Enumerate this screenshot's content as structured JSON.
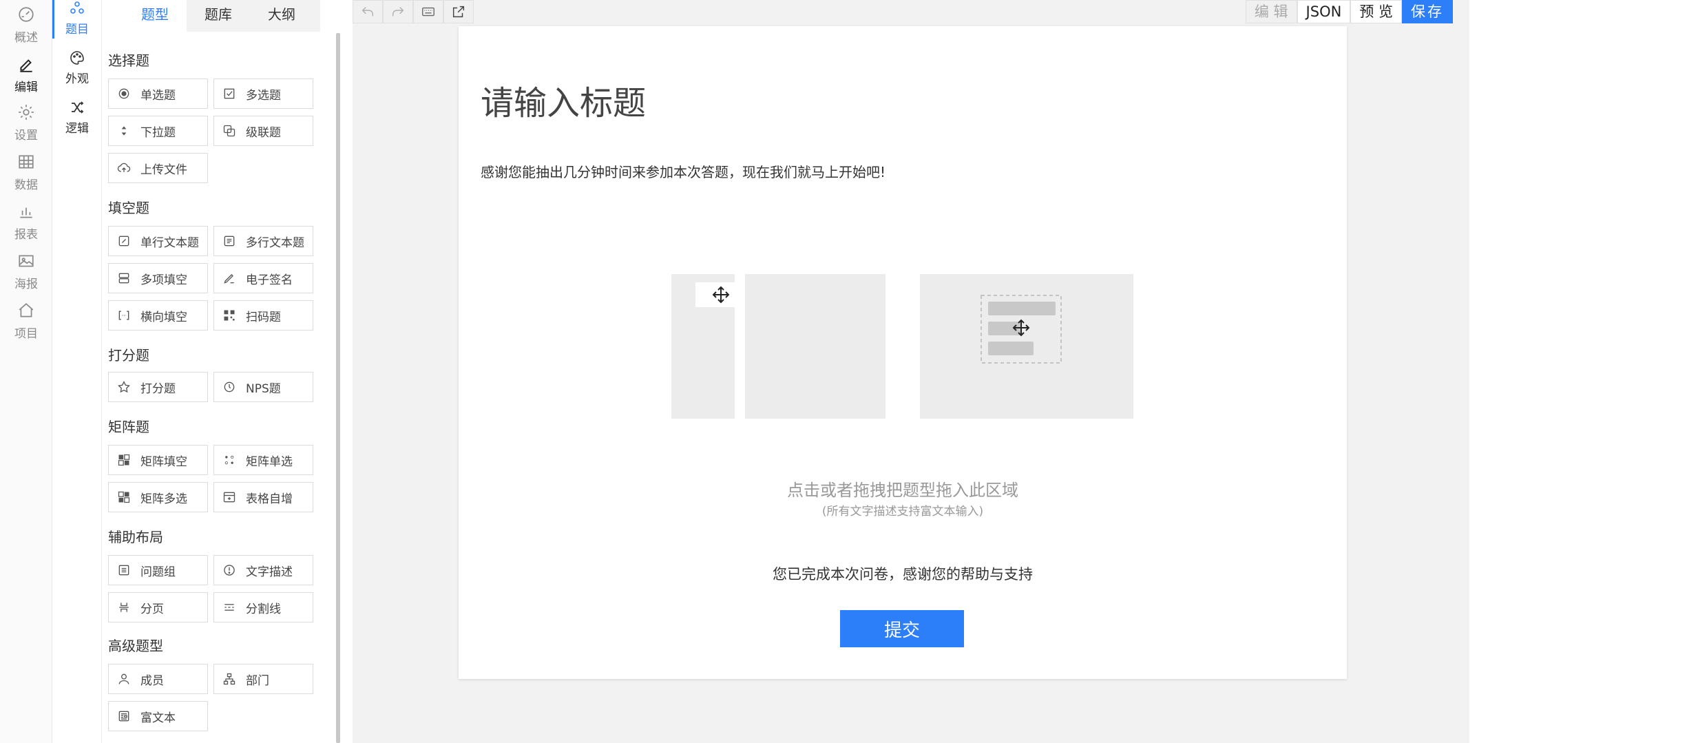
{
  "nav_primary": [
    {
      "label": "概述",
      "icon": "dashboard-icon",
      "active": false
    },
    {
      "label": "编辑",
      "icon": "pen-icon",
      "active": true
    },
    {
      "label": "设置",
      "icon": "gear-icon",
      "active": false
    },
    {
      "label": "数据",
      "icon": "table-icon",
      "active": false
    },
    {
      "label": "报表",
      "icon": "bar-chart-icon",
      "active": false
    },
    {
      "label": "海报",
      "icon": "image-icon",
      "active": false
    },
    {
      "label": "项目",
      "icon": "home-icon",
      "active": false
    }
  ],
  "nav_secondary": [
    {
      "label": "题目",
      "icon": "grid-circles-icon",
      "active": true
    },
    {
      "label": "外观",
      "icon": "palette-icon",
      "active": false
    },
    {
      "label": "逻辑",
      "icon": "shuffle-icon",
      "active": false
    }
  ],
  "panel_tabs": [
    "题型",
    "题库",
    "大纲"
  ],
  "categories": [
    {
      "title": "选择题",
      "items": [
        {
          "label": "单选题",
          "icon": "radio-icon"
        },
        {
          "label": "多选题",
          "icon": "checkbox-icon"
        },
        {
          "label": "下拉题",
          "icon": "dropdown-icon"
        },
        {
          "label": "级联题",
          "icon": "cascade-icon"
        },
        {
          "label": "上传文件",
          "icon": "upload-cloud-icon"
        }
      ]
    },
    {
      "title": "填空题",
      "items": [
        {
          "label": "单行文本题",
          "icon": "edit-box-icon"
        },
        {
          "label": "多行文本题",
          "icon": "multiline-icon"
        },
        {
          "label": "多项填空",
          "icon": "multi-fill-icon"
        },
        {
          "label": "电子签名",
          "icon": "signature-icon"
        },
        {
          "label": "横向填空",
          "icon": "bracket-icon"
        },
        {
          "label": "扫码题",
          "icon": "qrcode-icon"
        }
      ]
    },
    {
      "title": "打分题",
      "items": [
        {
          "label": "打分题",
          "icon": "star-icon"
        },
        {
          "label": "NPS题",
          "icon": "nps-icon"
        }
      ]
    },
    {
      "title": "矩阵题",
      "items": [
        {
          "label": "矩阵填空",
          "icon": "matrix-fill-icon"
        },
        {
          "label": "矩阵单选",
          "icon": "matrix-radio-icon"
        },
        {
          "label": "矩阵多选",
          "icon": "matrix-check-icon"
        },
        {
          "label": "表格自增",
          "icon": "table-add-icon"
        }
      ]
    },
    {
      "title": "辅助布局",
      "items": [
        {
          "label": "问题组",
          "icon": "group-icon"
        },
        {
          "label": "文字描述",
          "icon": "alert-circle-icon"
        },
        {
          "label": "分页",
          "icon": "page-break-icon"
        },
        {
          "label": "分割线",
          "icon": "divider-icon"
        }
      ]
    },
    {
      "title": "高级题型",
      "items": [
        {
          "label": "成员",
          "icon": "user-icon"
        },
        {
          "label": "部门",
          "icon": "org-icon"
        },
        {
          "label": "富文本",
          "icon": "rich-text-icon"
        }
      ]
    }
  ],
  "toolbar": {
    "undo_icon": "undo-icon",
    "redo_icon": "redo-icon",
    "keyboard_icon": "keyboard-icon",
    "export_icon": "export-icon",
    "edit_label": "编 辑",
    "json_label": "JSON",
    "preview_label": "预 览",
    "save_label": "保存"
  },
  "survey": {
    "title": "请输入标题",
    "description": "感谢您能抽出几分钟时间来参加本次答题，现在我们就马上开始吧!",
    "drop_hint": "点击或者拖拽把题型拖入此区域",
    "drop_sub": "(所有文字描述支持富文本输入)",
    "finish_text": "您已完成本次问卷，感谢您的帮助与支持",
    "submit_label": "提交"
  },
  "colors": {
    "accent": "#2d7ff9",
    "placeholder": "#ececec"
  }
}
